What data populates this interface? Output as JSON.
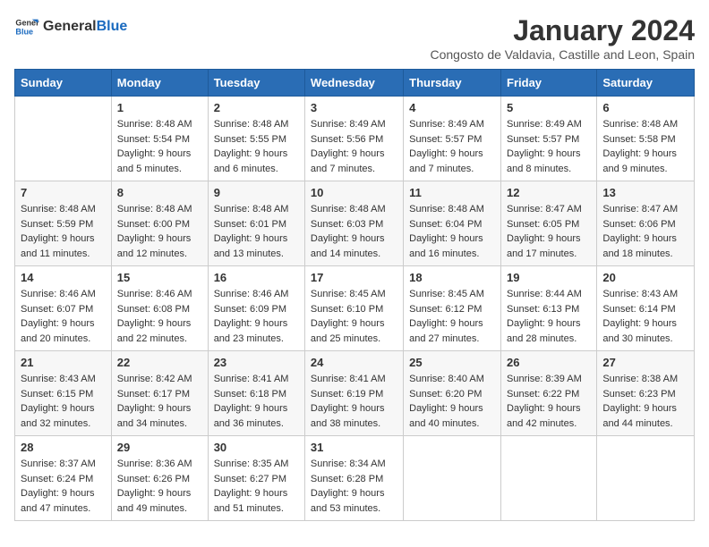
{
  "logo": {
    "general": "General",
    "blue": "Blue"
  },
  "title": "January 2024",
  "subtitle": "Congosto de Valdavia, Castille and Leon, Spain",
  "days_of_week": [
    "Sunday",
    "Monday",
    "Tuesday",
    "Wednesday",
    "Thursday",
    "Friday",
    "Saturday"
  ],
  "weeks": [
    [
      {
        "day": "",
        "lines": []
      },
      {
        "day": "1",
        "lines": [
          "Sunrise: 8:48 AM",
          "Sunset: 5:54 PM",
          "Daylight: 9 hours",
          "and 5 minutes."
        ]
      },
      {
        "day": "2",
        "lines": [
          "Sunrise: 8:48 AM",
          "Sunset: 5:55 PM",
          "Daylight: 9 hours",
          "and 6 minutes."
        ]
      },
      {
        "day": "3",
        "lines": [
          "Sunrise: 8:49 AM",
          "Sunset: 5:56 PM",
          "Daylight: 9 hours",
          "and 7 minutes."
        ]
      },
      {
        "day": "4",
        "lines": [
          "Sunrise: 8:49 AM",
          "Sunset: 5:57 PM",
          "Daylight: 9 hours",
          "and 7 minutes."
        ]
      },
      {
        "day": "5",
        "lines": [
          "Sunrise: 8:49 AM",
          "Sunset: 5:57 PM",
          "Daylight: 9 hours",
          "and 8 minutes."
        ]
      },
      {
        "day": "6",
        "lines": [
          "Sunrise: 8:48 AM",
          "Sunset: 5:58 PM",
          "Daylight: 9 hours",
          "and 9 minutes."
        ]
      }
    ],
    [
      {
        "day": "7",
        "lines": [
          "Sunrise: 8:48 AM",
          "Sunset: 5:59 PM",
          "Daylight: 9 hours",
          "and 11 minutes."
        ]
      },
      {
        "day": "8",
        "lines": [
          "Sunrise: 8:48 AM",
          "Sunset: 6:00 PM",
          "Daylight: 9 hours",
          "and 12 minutes."
        ]
      },
      {
        "day": "9",
        "lines": [
          "Sunrise: 8:48 AM",
          "Sunset: 6:01 PM",
          "Daylight: 9 hours",
          "and 13 minutes."
        ]
      },
      {
        "day": "10",
        "lines": [
          "Sunrise: 8:48 AM",
          "Sunset: 6:03 PM",
          "Daylight: 9 hours",
          "and 14 minutes."
        ]
      },
      {
        "day": "11",
        "lines": [
          "Sunrise: 8:48 AM",
          "Sunset: 6:04 PM",
          "Daylight: 9 hours",
          "and 16 minutes."
        ]
      },
      {
        "day": "12",
        "lines": [
          "Sunrise: 8:47 AM",
          "Sunset: 6:05 PM",
          "Daylight: 9 hours",
          "and 17 minutes."
        ]
      },
      {
        "day": "13",
        "lines": [
          "Sunrise: 8:47 AM",
          "Sunset: 6:06 PM",
          "Daylight: 9 hours",
          "and 18 minutes."
        ]
      }
    ],
    [
      {
        "day": "14",
        "lines": [
          "Sunrise: 8:46 AM",
          "Sunset: 6:07 PM",
          "Daylight: 9 hours",
          "and 20 minutes."
        ]
      },
      {
        "day": "15",
        "lines": [
          "Sunrise: 8:46 AM",
          "Sunset: 6:08 PM",
          "Daylight: 9 hours",
          "and 22 minutes."
        ]
      },
      {
        "day": "16",
        "lines": [
          "Sunrise: 8:46 AM",
          "Sunset: 6:09 PM",
          "Daylight: 9 hours",
          "and 23 minutes."
        ]
      },
      {
        "day": "17",
        "lines": [
          "Sunrise: 8:45 AM",
          "Sunset: 6:10 PM",
          "Daylight: 9 hours",
          "and 25 minutes."
        ]
      },
      {
        "day": "18",
        "lines": [
          "Sunrise: 8:45 AM",
          "Sunset: 6:12 PM",
          "Daylight: 9 hours",
          "and 27 minutes."
        ]
      },
      {
        "day": "19",
        "lines": [
          "Sunrise: 8:44 AM",
          "Sunset: 6:13 PM",
          "Daylight: 9 hours",
          "and 28 minutes."
        ]
      },
      {
        "day": "20",
        "lines": [
          "Sunrise: 8:43 AM",
          "Sunset: 6:14 PM",
          "Daylight: 9 hours",
          "and 30 minutes."
        ]
      }
    ],
    [
      {
        "day": "21",
        "lines": [
          "Sunrise: 8:43 AM",
          "Sunset: 6:15 PM",
          "Daylight: 9 hours",
          "and 32 minutes."
        ]
      },
      {
        "day": "22",
        "lines": [
          "Sunrise: 8:42 AM",
          "Sunset: 6:17 PM",
          "Daylight: 9 hours",
          "and 34 minutes."
        ]
      },
      {
        "day": "23",
        "lines": [
          "Sunrise: 8:41 AM",
          "Sunset: 6:18 PM",
          "Daylight: 9 hours",
          "and 36 minutes."
        ]
      },
      {
        "day": "24",
        "lines": [
          "Sunrise: 8:41 AM",
          "Sunset: 6:19 PM",
          "Daylight: 9 hours",
          "and 38 minutes."
        ]
      },
      {
        "day": "25",
        "lines": [
          "Sunrise: 8:40 AM",
          "Sunset: 6:20 PM",
          "Daylight: 9 hours",
          "and 40 minutes."
        ]
      },
      {
        "day": "26",
        "lines": [
          "Sunrise: 8:39 AM",
          "Sunset: 6:22 PM",
          "Daylight: 9 hours",
          "and 42 minutes."
        ]
      },
      {
        "day": "27",
        "lines": [
          "Sunrise: 8:38 AM",
          "Sunset: 6:23 PM",
          "Daylight: 9 hours",
          "and 44 minutes."
        ]
      }
    ],
    [
      {
        "day": "28",
        "lines": [
          "Sunrise: 8:37 AM",
          "Sunset: 6:24 PM",
          "Daylight: 9 hours",
          "and 47 minutes."
        ]
      },
      {
        "day": "29",
        "lines": [
          "Sunrise: 8:36 AM",
          "Sunset: 6:26 PM",
          "Daylight: 9 hours",
          "and 49 minutes."
        ]
      },
      {
        "day": "30",
        "lines": [
          "Sunrise: 8:35 AM",
          "Sunset: 6:27 PM",
          "Daylight: 9 hours",
          "and 51 minutes."
        ]
      },
      {
        "day": "31",
        "lines": [
          "Sunrise: 8:34 AM",
          "Sunset: 6:28 PM",
          "Daylight: 9 hours",
          "and 53 minutes."
        ]
      },
      {
        "day": "",
        "lines": []
      },
      {
        "day": "",
        "lines": []
      },
      {
        "day": "",
        "lines": []
      }
    ]
  ]
}
